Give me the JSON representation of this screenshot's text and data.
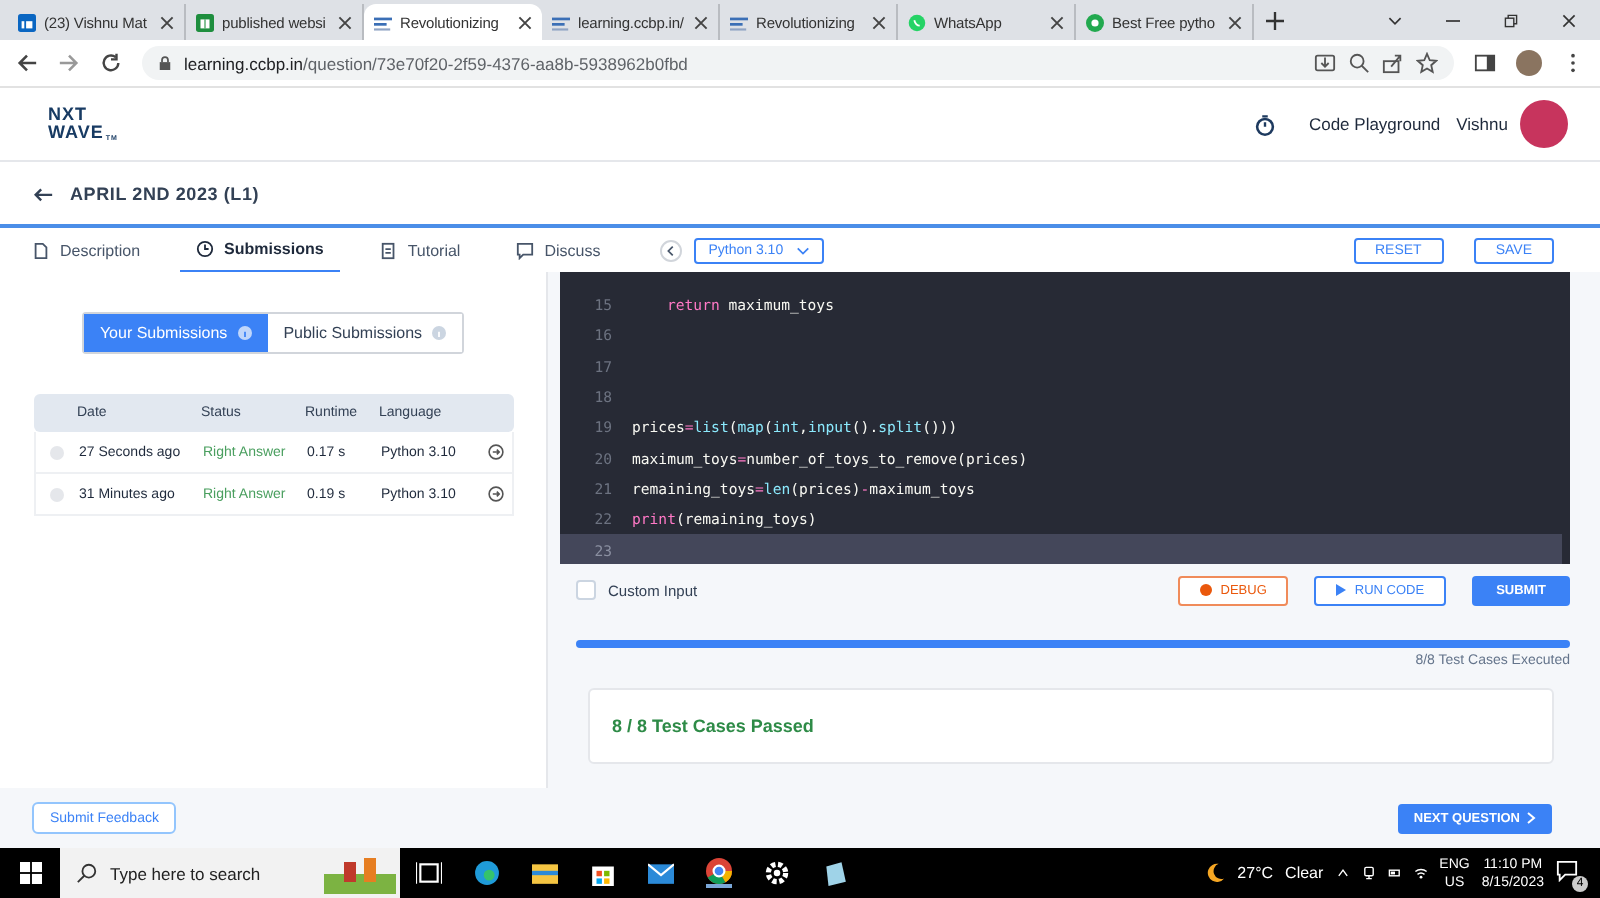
{
  "browser": {
    "tabs": [
      {
        "kind": "in",
        "title": "(23) Vishnu Mat",
        "selected": false
      },
      {
        "kind": "sheet",
        "title": "published websi",
        "selected": false
      },
      {
        "kind": "ccbp",
        "title": "Revolutionizing",
        "selected": true
      },
      {
        "kind": "ccbp",
        "title": "learning.ccbp.in/",
        "selected": false
      },
      {
        "kind": "ccbp",
        "title": "Revolutionizing",
        "selected": false
      },
      {
        "kind": "chat",
        "title": "WhatsApp",
        "selected": false
      },
      {
        "kind": "s",
        "title": "Best Free pytho",
        "selected": false
      }
    ],
    "url_host": "learning.ccbp.in",
    "url_path": "/question/73e70f20-2f59-4376-aa8b-5938962b0fbd"
  },
  "header": {
    "logo_top": "NXT",
    "logo_bottom": "WAVE",
    "logo_mark": "TM",
    "playground": "Code Playground",
    "user": "Vishnu"
  },
  "page_title": "APRIL 2ND 2023 (L1)",
  "tabs": [
    {
      "label": "Description",
      "kind": "doc",
      "selected": false
    },
    {
      "label": "Submissions",
      "kind": "clock",
      "selected": true
    },
    {
      "label": "Tutorial",
      "kind": "note",
      "selected": false
    },
    {
      "label": "Discuss",
      "kind": "chat",
      "selected": false
    }
  ],
  "language": "Python 3.10",
  "editor_buttons": [
    "RESET",
    "SAVE"
  ],
  "submission_toggle": [
    {
      "label": "Your Submissions",
      "selected": true
    },
    {
      "label": "Public Submissions",
      "selected": false
    }
  ],
  "table": {
    "columns": [
      "Date",
      "Status",
      "Runtime",
      "Language"
    ],
    "rows": [
      {
        "date": "27 Seconds ago",
        "status": "Right Answer",
        "runtime": "0.17 s",
        "language": "Python 3.10"
      },
      {
        "date": "31 Minutes ago",
        "status": "Right Answer",
        "runtime": "0.19 s",
        "language": "Python 3.10"
      }
    ]
  },
  "code": [
    {
      "number": "15",
      "current": false,
      "indent": true,
      "tokens": [
        {
          "kind": "kw",
          "text": "return"
        },
        {
          "kind": "plain",
          "text": " maximum_toys"
        }
      ]
    },
    {
      "number": "16",
      "current": false
    },
    {
      "number": "17",
      "current": false
    },
    {
      "number": "18",
      "current": false
    },
    {
      "number": "19",
      "current": false,
      "indent": false,
      "tokens": [
        {
          "kind": "plain",
          "text": "prices"
        },
        {
          "kind": "op",
          "text": "="
        },
        {
          "kind": "fn",
          "text": "list"
        },
        {
          "kind": "plain",
          "text": "("
        },
        {
          "kind": "fn",
          "text": "map"
        },
        {
          "kind": "plain",
          "text": "("
        },
        {
          "kind": "fn",
          "text": "int"
        },
        {
          "kind": "plain",
          "text": ","
        },
        {
          "kind": "fn",
          "text": "input"
        },
        {
          "kind": "plain",
          "text": "()."
        },
        {
          "kind": "fn",
          "text": "split"
        },
        {
          "kind": "plain",
          "text": "()))"
        }
      ]
    },
    {
      "number": "20",
      "current": false,
      "indent": false,
      "tokens": [
        {
          "kind": "plain",
          "text": "maximum_toys"
        },
        {
          "kind": "op",
          "text": "="
        },
        {
          "kind": "plain",
          "text": "number_of_toys_to_remove(prices)"
        }
      ]
    },
    {
      "number": "21",
      "current": false,
      "indent": false,
      "tokens": [
        {
          "kind": "plain",
          "text": "remaining_toys"
        },
        {
          "kind": "op",
          "text": "="
        },
        {
          "kind": "fn",
          "text": "len"
        },
        {
          "kind": "plain",
          "text": "(prices)"
        },
        {
          "kind": "op",
          "text": "-"
        },
        {
          "kind": "plain",
          "text": "maximum_toys"
        }
      ]
    },
    {
      "number": "22",
      "current": false,
      "indent": false,
      "tokens": [
        {
          "kind": "kw",
          "text": "print"
        },
        {
          "kind": "plain",
          "text": "(remaining_toys)"
        }
      ]
    },
    {
      "number": "23",
      "current": true
    }
  ],
  "custom_input": {
    "label": "Custom Input",
    "checked": false
  },
  "actions": [
    {
      "kind": "debug",
      "label": "DEBUG"
    },
    {
      "kind": "run",
      "label": "RUN CODE"
    },
    {
      "kind": "submit",
      "label": "SUBMIT"
    }
  ],
  "progress": {
    "level": 1.0,
    "caption": "8/8 Test Cases Executed"
  },
  "result": "8 / 8 Test Cases Passed",
  "feedback": "Submit Feedback",
  "next": "NEXT QUESTION",
  "taskbar": {
    "search_placeholder": "Type here to search",
    "temperature": "27°C",
    "weather": "Clear",
    "lang_top": "ENG",
    "lang_bottom": "US",
    "time": "11:10 PM",
    "date": "8/15/2023",
    "notifications": "4"
  }
}
